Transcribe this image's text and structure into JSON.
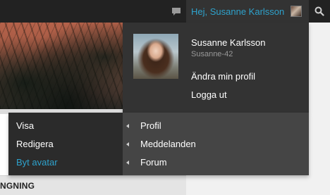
{
  "admin_bar": {
    "account_greeting": "Hej, Susanne Karlsson",
    "comments_icon": "comment-bubble-icon",
    "search_icon": "search-icon"
  },
  "account_menu": {
    "display_name": "Susanne Karlsson",
    "username": "Susanne-42",
    "edit_profile": "Ändra min profil",
    "logout": "Logga ut"
  },
  "profile_submenu": {
    "left_items": [
      "Visa",
      "Redigera",
      "Byt avatar"
    ],
    "active_left_item": "Byt avatar",
    "right_items": [
      "Profil",
      "Meddelanden",
      "Forum"
    ]
  },
  "page": {
    "section_heading": "NGNING"
  },
  "colors": {
    "admin_bar_bg": "#222222",
    "dropdown_bg": "#333333",
    "submenu_bg": "#454545",
    "accent_link": "#2ea2cc"
  }
}
